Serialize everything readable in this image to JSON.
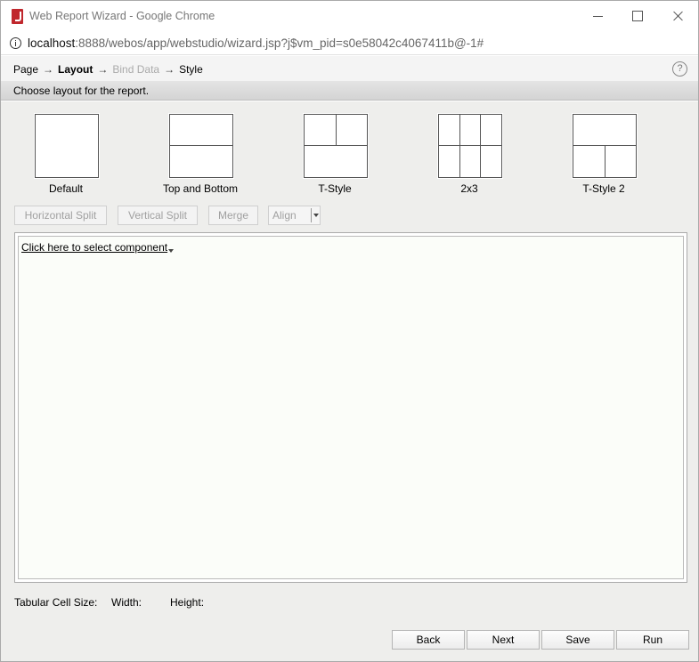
{
  "window": {
    "title": "Web Report Wizard - Google Chrome",
    "url_host": "localhost",
    "url_rest": ":8888/webos/app/webstudio/wizard.jsp?j$vm_pid=s0e58042c4067411b@-1#"
  },
  "wizard": {
    "steps": [
      {
        "label": "Page",
        "state": "done"
      },
      {
        "label": "Layout",
        "state": "current"
      },
      {
        "label": "Bind Data",
        "state": "disabled"
      },
      {
        "label": "Style",
        "state": "pending"
      }
    ],
    "arrow": "→",
    "help": "?",
    "instruction": "Choose layout for the report."
  },
  "layouts": [
    {
      "label": "Default"
    },
    {
      "label": "Top and Bottom"
    },
    {
      "label": "T-Style"
    },
    {
      "label": "2x3"
    },
    {
      "label": "T-Style 2"
    }
  ],
  "toolbar": {
    "horizontal_split": "Horizontal Split",
    "vertical_split": "Vertical Split",
    "merge": "Merge",
    "align": "Align"
  },
  "canvas": {
    "select_component": "Click here to select component"
  },
  "cell_size": {
    "label": "Tabular Cell Size:",
    "width_label": "Width:",
    "height_label": "Height:"
  },
  "buttons": {
    "back": "Back",
    "next": "Next",
    "save": "Save",
    "run": "Run"
  },
  "colors": {
    "app_icon": "#c0272d",
    "content_bg": "#eeeeec",
    "instruction_bar": "#d9d9d9"
  }
}
